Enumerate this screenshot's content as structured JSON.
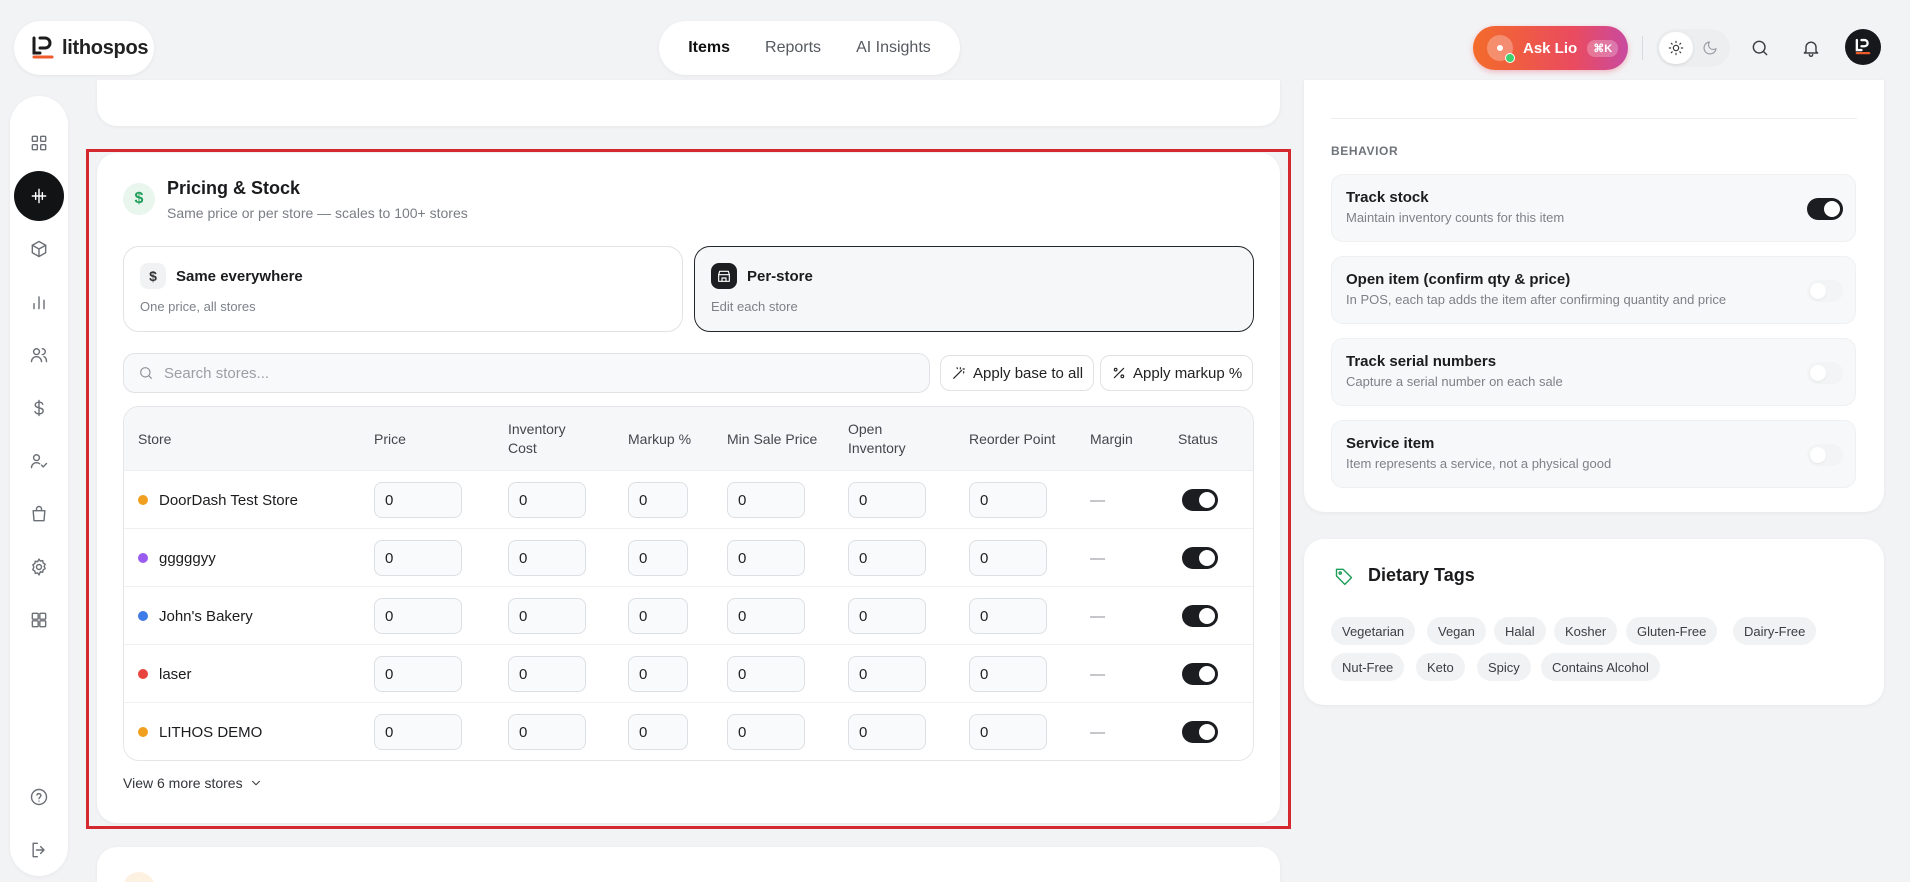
{
  "brand": {
    "name": "lithospos"
  },
  "nav": {
    "tabs": [
      {
        "label": "Items"
      },
      {
        "label": "Reports"
      },
      {
        "label": "AI Insights"
      }
    ]
  },
  "header": {
    "ask_label": "Ask Lio",
    "ask_shortcut": "⌘K"
  },
  "pricing": {
    "title": "Pricing & Stock",
    "subtitle": "Same price or per store — scales to 100+ stores",
    "modes": [
      {
        "title": "Same everywhere",
        "subtitle": "One price, all stores"
      },
      {
        "title": "Per-store",
        "subtitle": "Edit each store",
        "selected": true
      }
    ],
    "search_placeholder": "Search stores...",
    "apply_base_label": "Apply base to all",
    "apply_markup_label": "Apply markup %",
    "columns": [
      "Store",
      "Price",
      "Inventory Cost",
      "Markup %",
      "Min Sale Price",
      "Open Inventory",
      "Reorder Point",
      "Margin",
      "Status"
    ],
    "rows": [
      {
        "store": "DoorDash Test Store",
        "color": "#f0a01e",
        "price": "0",
        "cost": "0",
        "markup": "0",
        "min_sale": "0",
        "open_inv": "0",
        "reorder": "0",
        "margin": "—",
        "status": true
      },
      {
        "store": "gggggyy",
        "color": "#9a5cf0",
        "price": "0",
        "cost": "0",
        "markup": "0",
        "min_sale": "0",
        "open_inv": "0",
        "reorder": "0",
        "margin": "—",
        "status": true
      },
      {
        "store": "John's Bakery",
        "color": "#3f7be8",
        "price": "0",
        "cost": "0",
        "markup": "0",
        "min_sale": "0",
        "open_inv": "0",
        "reorder": "0",
        "margin": "—",
        "status": true
      },
      {
        "store": "laser",
        "color": "#e8453e",
        "price": "0",
        "cost": "0",
        "markup": "0",
        "min_sale": "0",
        "open_inv": "0",
        "reorder": "0",
        "margin": "—",
        "status": true
      },
      {
        "store": "LITHOS DEMO",
        "color": "#f0a01e",
        "price": "0",
        "cost": "0",
        "markup": "0",
        "min_sale": "0",
        "open_inv": "0",
        "reorder": "0",
        "margin": "—",
        "status": true
      }
    ],
    "view_more_label": "View 6 more stores"
  },
  "behavior": {
    "label": "BEHAVIOR",
    "items": [
      {
        "title": "Track stock",
        "subtitle": "Maintain inventory counts for this item",
        "on": true
      },
      {
        "title": "Open item (confirm qty & price)",
        "subtitle": "In POS, each tap adds the item after confirming quantity and price",
        "on": false
      },
      {
        "title": "Track serial numbers",
        "subtitle": "Capture a serial number on each sale",
        "on": false
      },
      {
        "title": "Service item",
        "subtitle": "Item represents a service, not a physical good",
        "on": false
      }
    ]
  },
  "dietary": {
    "title": "Dietary Tags",
    "tags": [
      "Vegetarian",
      "Vegan",
      "Halal",
      "Kosher",
      "Gluten-Free",
      "Dairy-Free",
      "Nut-Free",
      "Keto",
      "Spicy",
      "Contains Alcohol"
    ]
  },
  "colors": {
    "accent": "#ef5a2b",
    "highlight": "#d42a2f",
    "dark": "#111315"
  }
}
